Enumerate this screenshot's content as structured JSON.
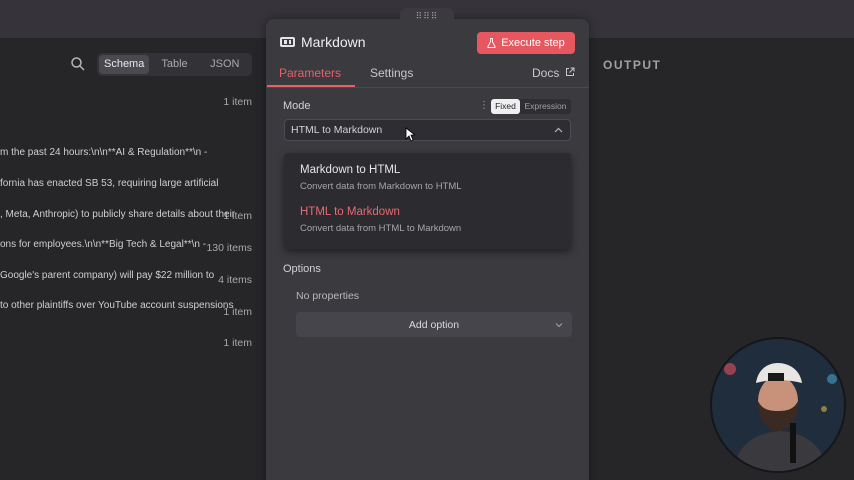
{
  "input_panel": {
    "view_tabs": [
      "Schema",
      "Table",
      "JSON"
    ],
    "active_view": "Schema",
    "counts": [
      "1 item",
      "1 item",
      "130 items",
      "4 items",
      "1 item",
      "1 item"
    ],
    "json_lines": [
      "m the past 24 hours:\\n\\n**AI & Regulation**\\n -",
      "fornia has enacted SB 53, requiring large artificial",
      ", Meta, Anthropic) to publicly share details about their",
      "ons for employees.\\n\\n**Big Tech & Legal**\\n -",
      "Google's parent company) will pay $22 million to",
      "to other plaintiffs over YouTube account suspensions"
    ]
  },
  "output_panel": {
    "label": "OUTPUT"
  },
  "node": {
    "title": "Markdown",
    "icon": "markdown-icon",
    "execute_label": "Execute step",
    "tabs": {
      "parameters": "Parameters",
      "settings": "Settings",
      "docs": "Docs"
    },
    "mode": {
      "label": "Mode",
      "toggle": {
        "fixed": "Fixed",
        "expression": "Expression"
      },
      "selected": "HTML to Markdown",
      "options": [
        {
          "title": "Markdown to HTML",
          "desc": "Convert data from Markdown to HTML",
          "selected": false
        },
        {
          "title": "HTML to Markdown",
          "desc": "Convert data from HTML to Markdown",
          "selected": true
        }
      ]
    },
    "options": {
      "label": "Options",
      "empty_text": "No properties",
      "add_label": "Add option"
    }
  },
  "colors": {
    "accent": "#e6575f",
    "panel_bg": "#3b3a3f",
    "page_bg": "#262628"
  }
}
